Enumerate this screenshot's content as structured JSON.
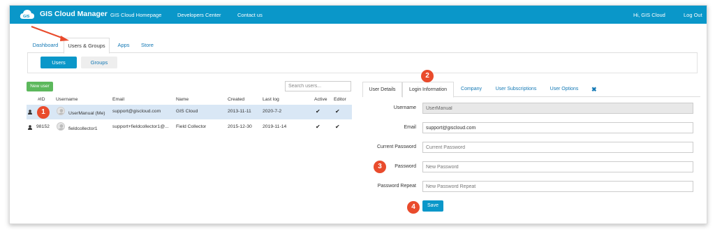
{
  "topbar": {
    "title": "GIS Cloud Manager",
    "logo_text": "GIS",
    "nav": [
      "GIS Cloud Homepage",
      "Developers Center",
      "Contact us"
    ],
    "greeting": "Hi, GIS Cloud",
    "logout": "Log Out",
    "color": "#0a97c9"
  },
  "main_tabs": [
    "Dashboard",
    "Users & Groups",
    "Apps",
    "Store"
  ],
  "sub_tabs": {
    "users": "Users",
    "groups": "Groups"
  },
  "users_panel": {
    "new_user": "New user",
    "search_placeholder": "Search users...",
    "columns": [
      "#ID",
      "Username",
      "Email",
      "Name",
      "Created",
      "Last log",
      "Active",
      "Editor"
    ],
    "rows": [
      {
        "id": "",
        "username": "UserManual (Me)",
        "email": "support@giscloud.com",
        "name": "GIS Cloud",
        "created": "2013-11-11",
        "last_log": "2020-7-2",
        "active": "✔",
        "editor": "✔"
      },
      {
        "id": "98152",
        "username": "fieldcollector1",
        "email": "support+fieldcollector1@...",
        "name": "Field Collector",
        "created": "2015-12-30",
        "last_log": "2019-11-14",
        "active": "✔",
        "editor": "✔"
      }
    ]
  },
  "detail_tabs": [
    "User Details",
    "Login Information",
    "Company",
    "User Subscriptions",
    "User Options"
  ],
  "close_icon": "✖",
  "form": {
    "username_label": "Username",
    "username_value": "UserManual",
    "email_label": "Email",
    "email_value": "support@giscloud.com",
    "current_password_label": "Current Password",
    "current_password_placeholder": "Current Password",
    "password_label": "Password",
    "password_placeholder": "New Password",
    "password_repeat_label": "Password Repeat",
    "password_repeat_placeholder": "New Password Repeat",
    "save": "Save"
  },
  "markers": [
    "1",
    "2",
    "3",
    "4"
  ],
  "annotation_color": "#e94b2c"
}
